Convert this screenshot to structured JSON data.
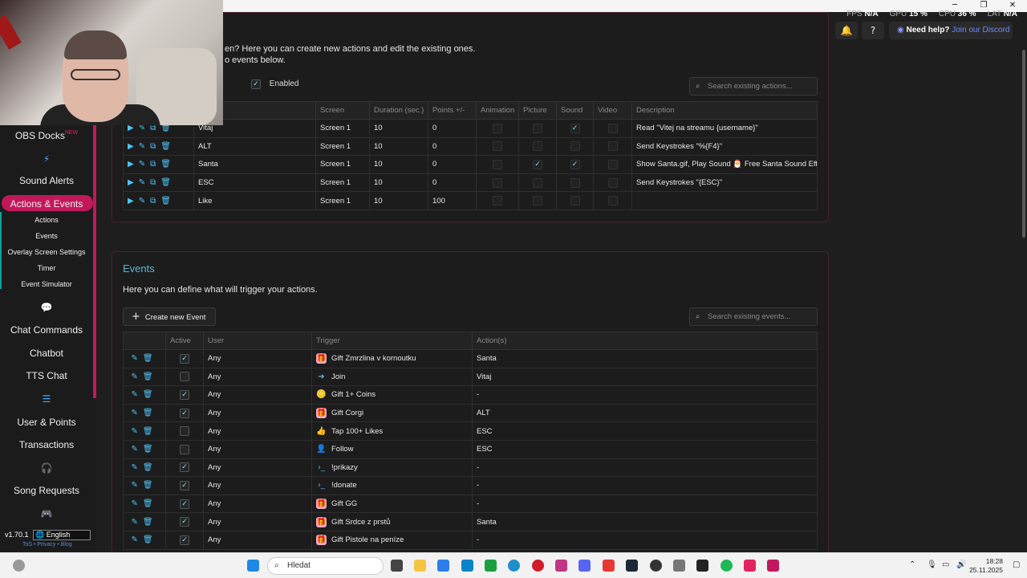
{
  "window": {
    "minimize": "─",
    "maximize": "❐",
    "close": "✕"
  },
  "stats": {
    "fps_label": "FPS",
    "fps": "N/A",
    "gpu_label": "GPU",
    "gpu": "15 %",
    "cpu_label": "CPU",
    "cpu": "36 %",
    "lat_label": "LAT",
    "lat": "N/A"
  },
  "header": {
    "help_text": "Need help?",
    "help_link": "Join our Discord"
  },
  "sidebar": {
    "obs_docks": "OBS Docks",
    "new_tag": "NEW",
    "sound_alerts": "Sound Alerts",
    "actions_events": "Actions & Events",
    "sub": [
      "Actions",
      "Events",
      "Overlay Screen Settings",
      "Timer",
      "Event Simulator"
    ],
    "chat_commands": "Chat Commands",
    "chatbot": "Chatbot",
    "tts_chat": "TTS Chat",
    "user_points": "User & Points",
    "transactions": "Transactions",
    "song_requests": "Song Requests",
    "version": "v1.70.1",
    "language": "English",
    "tos": "ToS • Privacy • Blog"
  },
  "actions": {
    "intro1": "en? Here you can create new actions and edit the existing ones.",
    "intro2": "o events below.",
    "enabled_label": "Enabled",
    "search_placeholder": "Search existing actions...",
    "columns": [
      "Screen",
      "Duration (sec.)",
      "Points +/-",
      "Animation",
      "Picture",
      "Sound",
      "Video",
      "Description"
    ],
    "rows": [
      {
        "name": "Vitaj",
        "screen": "Screen 1",
        "duration": "10",
        "points": "0",
        "picture": false,
        "sound": true,
        "desc": "Read \"Vitej na streamu {username}\""
      },
      {
        "name": "ALT",
        "screen": "Screen 1",
        "duration": "10",
        "points": "0",
        "picture": false,
        "sound": false,
        "desc": "Send Keystrokes \"%{F4}\""
      },
      {
        "name": "Santa",
        "screen": "Screen 1",
        "duration": "10",
        "points": "0",
        "picture": true,
        "sound": true,
        "desc": "Show Santa.gif, Play Sound 🎅 Free Santa Sound Eff..."
      },
      {
        "name": "ESC",
        "screen": "Screen 1",
        "duration": "10",
        "points": "0",
        "picture": false,
        "sound": false,
        "desc": "Send Keystrokes \"{ESC}\""
      },
      {
        "name": "Like",
        "screen": "Screen 1",
        "duration": "10",
        "points": "100",
        "picture": false,
        "sound": false,
        "desc": ""
      }
    ]
  },
  "events": {
    "title": "Events",
    "intro": "Here you can define what will trigger your actions.",
    "create_button": "Create new Event",
    "search_placeholder": "Search existing events...",
    "columns": [
      "Active",
      "User",
      "Trigger",
      "Action(s)"
    ],
    "rows": [
      {
        "active": true,
        "user": "Any",
        "trigger": "Gift Zmrzlina v kornoutku",
        "icon": "gift",
        "action": "Santa"
      },
      {
        "active": false,
        "user": "Any",
        "trigger": "Join",
        "icon": "join",
        "action": "Vitaj"
      },
      {
        "active": true,
        "user": "Any",
        "trigger": "Gift 1+ Coins",
        "icon": "coins",
        "action": "-"
      },
      {
        "active": true,
        "user": "Any",
        "trigger": "Gift Corgi",
        "icon": "gift",
        "action": "ALT"
      },
      {
        "active": false,
        "user": "Any",
        "trigger": "Tap 100+ Likes",
        "icon": "like",
        "action": "ESC"
      },
      {
        "active": false,
        "user": "Any",
        "trigger": "Follow",
        "icon": "follow",
        "action": "ESC"
      },
      {
        "active": true,
        "user": "Any",
        "trigger": "!prikazy",
        "icon": "command",
        "action": "-"
      },
      {
        "active": true,
        "user": "Any",
        "trigger": "!donate",
        "icon": "command",
        "action": "-"
      },
      {
        "active": true,
        "user": "Any",
        "trigger": "Gift GG",
        "icon": "gift",
        "action": "-"
      },
      {
        "active": true,
        "user": "Any",
        "trigger": "Gift Srdce z prstů",
        "icon": "gift",
        "action": "Santa"
      },
      {
        "active": true,
        "user": "Any",
        "trigger": "Gift Pistole na peníze",
        "icon": "gift",
        "action": "-"
      }
    ]
  },
  "taskbar": {
    "search": "Hledat",
    "time": "18:28",
    "date": "25.11.2025"
  }
}
